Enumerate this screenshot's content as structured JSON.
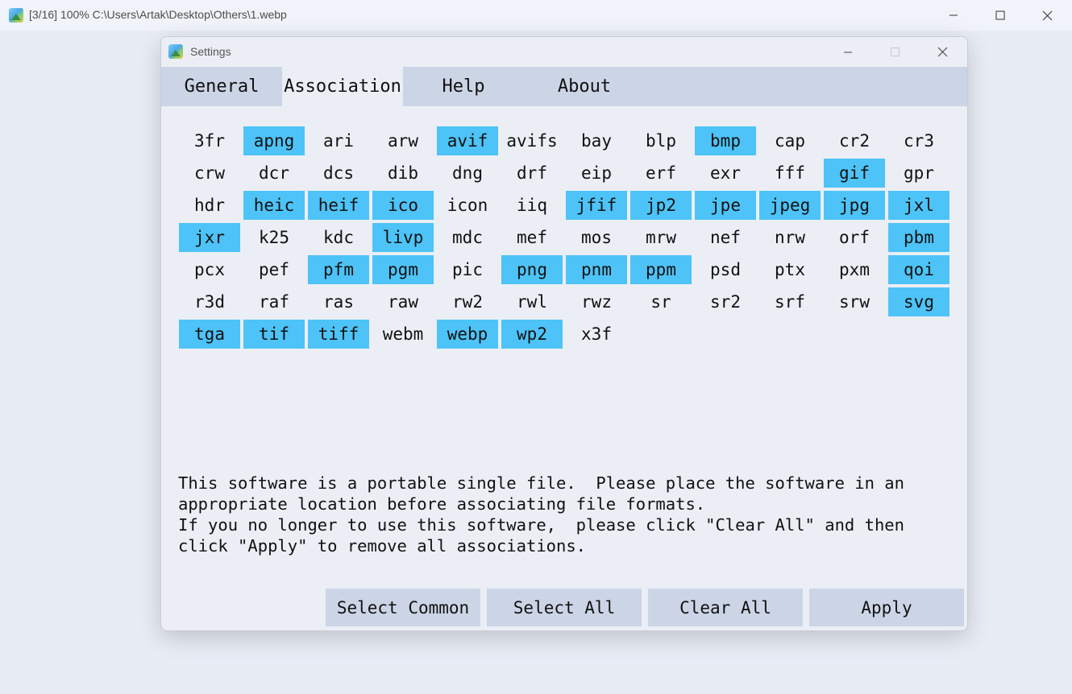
{
  "main_window": {
    "title": "[3/16] 100% C:\\Users\\Artak\\Desktop\\Others\\1.webp"
  },
  "dialog": {
    "title": "Settings"
  },
  "tabs": [
    {
      "label": "General",
      "active": false
    },
    {
      "label": "Association",
      "active": true
    },
    {
      "label": "Help",
      "active": false
    },
    {
      "label": "About",
      "active": false
    }
  ],
  "formats": [
    {
      "ext": "3fr",
      "selected": false
    },
    {
      "ext": "apng",
      "selected": true
    },
    {
      "ext": "ari",
      "selected": false
    },
    {
      "ext": "arw",
      "selected": false
    },
    {
      "ext": "avif",
      "selected": true
    },
    {
      "ext": "avifs",
      "selected": false
    },
    {
      "ext": "bay",
      "selected": false
    },
    {
      "ext": "blp",
      "selected": false
    },
    {
      "ext": "bmp",
      "selected": true
    },
    {
      "ext": "cap",
      "selected": false
    },
    {
      "ext": "cr2",
      "selected": false
    },
    {
      "ext": "cr3",
      "selected": false
    },
    {
      "ext": "crw",
      "selected": false
    },
    {
      "ext": "dcr",
      "selected": false
    },
    {
      "ext": "dcs",
      "selected": false
    },
    {
      "ext": "dib",
      "selected": false
    },
    {
      "ext": "dng",
      "selected": false
    },
    {
      "ext": "drf",
      "selected": false
    },
    {
      "ext": "eip",
      "selected": false
    },
    {
      "ext": "erf",
      "selected": false
    },
    {
      "ext": "exr",
      "selected": false
    },
    {
      "ext": "fff",
      "selected": false
    },
    {
      "ext": "gif",
      "selected": true
    },
    {
      "ext": "gpr",
      "selected": false
    },
    {
      "ext": "hdr",
      "selected": false
    },
    {
      "ext": "heic",
      "selected": true
    },
    {
      "ext": "heif",
      "selected": true
    },
    {
      "ext": "ico",
      "selected": true
    },
    {
      "ext": "icon",
      "selected": false
    },
    {
      "ext": "iiq",
      "selected": false
    },
    {
      "ext": "jfif",
      "selected": true
    },
    {
      "ext": "jp2",
      "selected": true
    },
    {
      "ext": "jpe",
      "selected": true
    },
    {
      "ext": "jpeg",
      "selected": true
    },
    {
      "ext": "jpg",
      "selected": true
    },
    {
      "ext": "jxl",
      "selected": true
    },
    {
      "ext": "jxr",
      "selected": true
    },
    {
      "ext": "k25",
      "selected": false
    },
    {
      "ext": "kdc",
      "selected": false
    },
    {
      "ext": "livp",
      "selected": true
    },
    {
      "ext": "mdc",
      "selected": false
    },
    {
      "ext": "mef",
      "selected": false
    },
    {
      "ext": "mos",
      "selected": false
    },
    {
      "ext": "mrw",
      "selected": false
    },
    {
      "ext": "nef",
      "selected": false
    },
    {
      "ext": "nrw",
      "selected": false
    },
    {
      "ext": "orf",
      "selected": false
    },
    {
      "ext": "pbm",
      "selected": true
    },
    {
      "ext": "pcx",
      "selected": false
    },
    {
      "ext": "pef",
      "selected": false
    },
    {
      "ext": "pfm",
      "selected": true
    },
    {
      "ext": "pgm",
      "selected": true
    },
    {
      "ext": "pic",
      "selected": false
    },
    {
      "ext": "png",
      "selected": true
    },
    {
      "ext": "pnm",
      "selected": true
    },
    {
      "ext": "ppm",
      "selected": true
    },
    {
      "ext": "psd",
      "selected": false
    },
    {
      "ext": "ptx",
      "selected": false
    },
    {
      "ext": "pxm",
      "selected": false
    },
    {
      "ext": "qoi",
      "selected": true
    },
    {
      "ext": "r3d",
      "selected": false
    },
    {
      "ext": "raf",
      "selected": false
    },
    {
      "ext": "ras",
      "selected": false
    },
    {
      "ext": "raw",
      "selected": false
    },
    {
      "ext": "rw2",
      "selected": false
    },
    {
      "ext": "rwl",
      "selected": false
    },
    {
      "ext": "rwz",
      "selected": false
    },
    {
      "ext": "sr",
      "selected": false
    },
    {
      "ext": "sr2",
      "selected": false
    },
    {
      "ext": "srf",
      "selected": false
    },
    {
      "ext": "srw",
      "selected": false
    },
    {
      "ext": "svg",
      "selected": true
    },
    {
      "ext": "tga",
      "selected": true
    },
    {
      "ext": "tif",
      "selected": true
    },
    {
      "ext": "tiff",
      "selected": true
    },
    {
      "ext": "webm",
      "selected": false
    },
    {
      "ext": "webp",
      "selected": true
    },
    {
      "ext": "wp2",
      "selected": true
    },
    {
      "ext": "x3f",
      "selected": false
    }
  ],
  "info_text": "This software is a portable single file.  Please place the software in an\nappropriate location before associating file formats.\nIf you no longer to use this software,  please click \"Clear All\" and then\nclick \"Apply\" to remove all associations.",
  "buttons": {
    "select_common": "Select Common",
    "select_all": "Select All",
    "clear_all": "Clear All",
    "apply": "Apply"
  },
  "colors": {
    "selected": "#4dc3f7",
    "tab_bar": "#ccd5e6",
    "button": "#ccd5e6",
    "background": "#ebeef5"
  }
}
